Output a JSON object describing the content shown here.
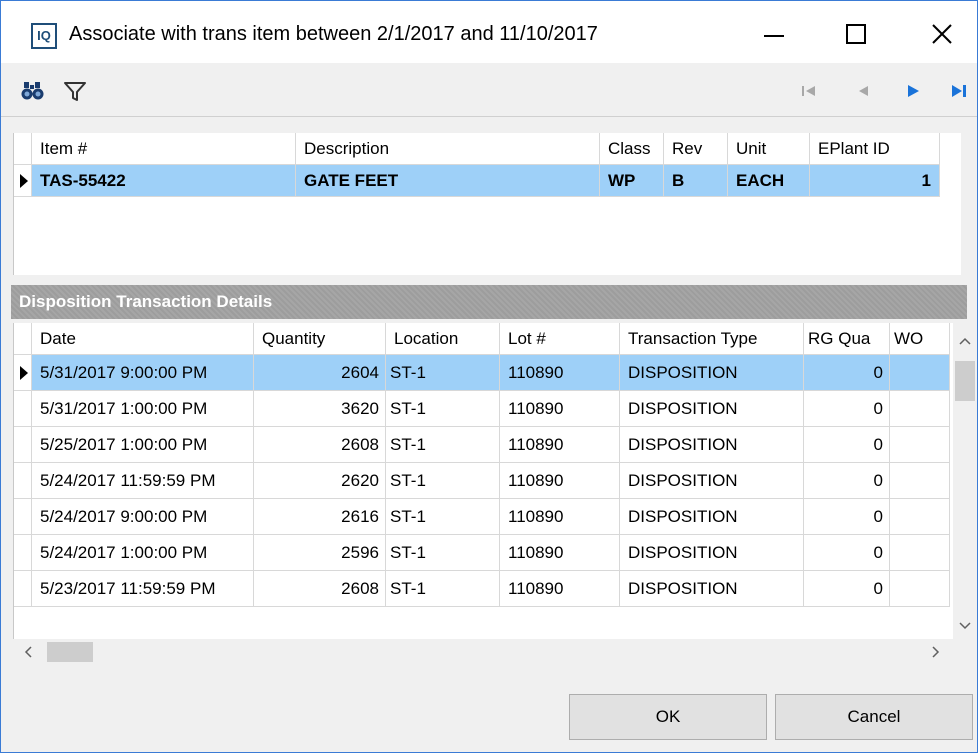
{
  "window": {
    "app_icon_text": "IQ",
    "title": "Associate with trans item between 2/1/2017 and 11/10/2017"
  },
  "toolbar": {
    "icons": [
      "binoculars-icon",
      "filter-icon",
      "first-record-icon",
      "prev-record-icon",
      "next-record-icon",
      "last-record-icon"
    ]
  },
  "item_grid": {
    "columns": [
      "Item #",
      "Description",
      "Class",
      "Rev",
      "Unit",
      "EPlant ID"
    ],
    "rows": [
      {
        "item": "TAS-55422",
        "description": "GATE FEET",
        "class": "WP",
        "rev": "B",
        "unit": "EACH",
        "eplant_id": "1"
      }
    ]
  },
  "section": {
    "title": "Disposition Transaction Details"
  },
  "details_grid": {
    "columns": [
      "Date",
      "Quantity",
      "Location",
      "Lot #",
      "Transaction Type",
      "RG Qua",
      "WO"
    ],
    "rows": [
      {
        "date": "5/31/2017 9:00:00 PM",
        "quantity": "2604",
        "location": "ST-1",
        "lot": "110890",
        "type": "DISPOSITION",
        "rg": "0"
      },
      {
        "date": "5/31/2017 1:00:00 PM",
        "quantity": "3620",
        "location": "ST-1",
        "lot": "110890",
        "type": "DISPOSITION",
        "rg": "0"
      },
      {
        "date": "5/25/2017 1:00:00 PM",
        "quantity": "2608",
        "location": "ST-1",
        "lot": "110890",
        "type": "DISPOSITION",
        "rg": "0"
      },
      {
        "date": "5/24/2017 11:59:59 PM",
        "quantity": "2620",
        "location": "ST-1",
        "lot": "110890",
        "type": "DISPOSITION",
        "rg": "0"
      },
      {
        "date": "5/24/2017 9:00:00 PM",
        "quantity": "2616",
        "location": "ST-1",
        "lot": "110890",
        "type": "DISPOSITION",
        "rg": "0"
      },
      {
        "date": "5/24/2017 1:00:00 PM",
        "quantity": "2596",
        "location": "ST-1",
        "lot": "110890",
        "type": "DISPOSITION",
        "rg": "0"
      },
      {
        "date": "5/23/2017 11:59:59 PM",
        "quantity": "2608",
        "location": "ST-1",
        "lot": "110890",
        "type": "DISPOSITION",
        "rg": "0"
      }
    ]
  },
  "buttons": {
    "ok": "OK",
    "cancel": "Cancel"
  },
  "colors": {
    "selection": "#9ed0f8",
    "section_header": "#a0a0a0",
    "nav_blue": "#1a73d9"
  }
}
